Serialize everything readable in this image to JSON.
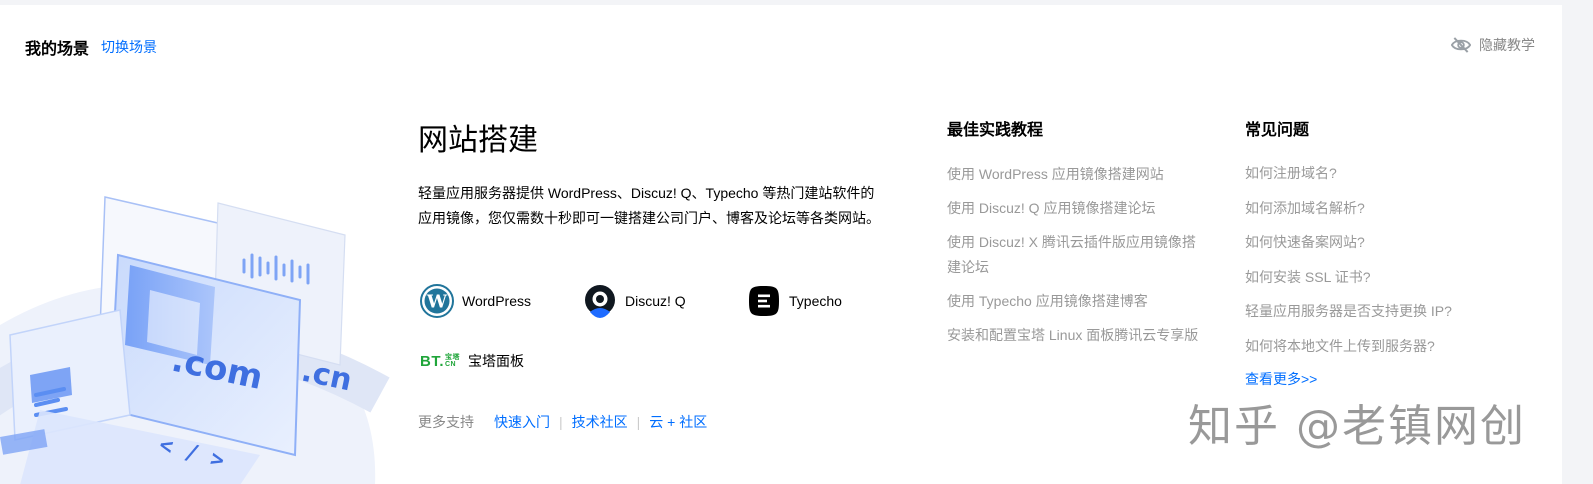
{
  "header": {
    "title": "我的场景",
    "switch_label": "切换场景",
    "hide_label": "隐藏教学"
  },
  "illustration": {
    "text_com": ".com",
    "text_cn": ".cn",
    "text_code": "< / >"
  },
  "main": {
    "title": "网站搭建",
    "description": "轻量应用服务器提供 WordPress、Discuz! Q、Typecho 等热门建站软件的应用镜像，您仅需数十秒即可一键搭建公司门户、博客及论坛等各类网站。",
    "apps": [
      {
        "name": "WordPress",
        "icon": "wordpress-logo"
      },
      {
        "name": "Discuz! Q",
        "icon": "discuz-logo"
      },
      {
        "name": "Typecho",
        "icon": "typecho-logo"
      },
      {
        "name": "宝塔面板",
        "icon": "bt-logo"
      }
    ],
    "bt_logo_text": "BT.",
    "bt_logo_small_top": "宝塔",
    "bt_logo_small_bottom": "CN",
    "more_support": {
      "label": "更多支持",
      "links": [
        "快速入门",
        "技术社区",
        "云 + 社区"
      ]
    }
  },
  "tutorials": {
    "title": "最佳实践教程",
    "items": [
      "使用 WordPress 应用镜像搭建网站",
      "使用 Discuz! Q 应用镜像搭建论坛",
      "使用 Discuz! X 腾讯云插件版应用镜像搭建论坛",
      "使用 Typecho 应用镜像搭建博客",
      "安装和配置宝塔 Linux 面板腾讯云专享版"
    ]
  },
  "faq": {
    "title": "常见问题",
    "items": [
      "如何注册域名?",
      "如何添加域名解析?",
      "如何快速备案网站?",
      "如何安装 SSL 证书?",
      "轻量应用服务器是否支持更换 IP?",
      "如何将本地文件上传到服务器?"
    ],
    "more_label": "查看更多>>"
  },
  "watermark": "知乎 @老镇网创",
  "colors": {
    "accent": "#006eff",
    "muted": "#999999",
    "bt_green": "#20a53a",
    "wordpress_blue": "#21759b"
  }
}
